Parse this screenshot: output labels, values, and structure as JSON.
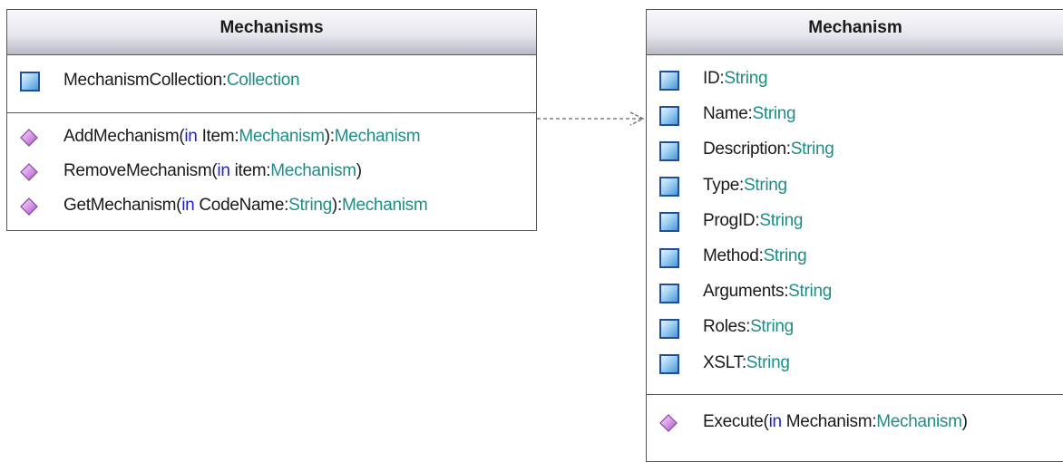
{
  "classes": {
    "mechanisms": {
      "name": "Mechanisms",
      "attributes": [
        {
          "name": "MechanismCollection",
          "sep": ":",
          "type": "Collection"
        }
      ],
      "operations": [
        {
          "name": "AddMechanism(",
          "kw": "in",
          "param": " Item:",
          "ptype": "Mechanism",
          "close": "):",
          "ret": "Mechanism"
        },
        {
          "name": "RemoveMechanism(",
          "kw": "in",
          "param": " item:",
          "ptype": "Mechanism",
          "close": ")",
          "ret": ""
        },
        {
          "name": "GetMechanism(",
          "kw": "in",
          "param": " CodeName:",
          "ptype": "String",
          "close": "):",
          "ret": "Mechanism"
        }
      ]
    },
    "mechanism": {
      "name": "Mechanism",
      "attributes": [
        {
          "name": "ID",
          "sep": ":",
          "type": "String"
        },
        {
          "name": "Name",
          "sep": ":",
          "type": "String"
        },
        {
          "name": "Description",
          "sep": ":",
          "type": "String"
        },
        {
          "name": "Type",
          "sep": ":",
          "type": "String"
        },
        {
          "name": "ProgID",
          "sep": ":",
          "type": "String"
        },
        {
          "name": "Method",
          "sep": ":",
          "type": "String"
        },
        {
          "name": "Arguments",
          "sep": ":",
          "type": "String"
        },
        {
          "name": "Roles",
          "sep": ":",
          "type": "String"
        },
        {
          "name": "XSLT",
          "sep": ":",
          "type": "String"
        }
      ],
      "operations": [
        {
          "name": "Execute(",
          "kw": "in",
          "param": " Mechanism:",
          "ptype": "Mechanism",
          "close": ")",
          "ret": ""
        }
      ]
    }
  },
  "colors": {
    "keyword": "#1f1fd6",
    "type": "#1e8c87",
    "attribute_icon": "#4d95d6",
    "operation_icon": "#c47ad8",
    "border": "#555555"
  },
  "icons": {
    "attribute": "attribute-icon",
    "operation": "operation-icon"
  },
  "relations": [
    {
      "kind": "dependency",
      "from": "Mechanisms",
      "to": "Mechanism",
      "style": "dashed-open-arrow"
    }
  ]
}
